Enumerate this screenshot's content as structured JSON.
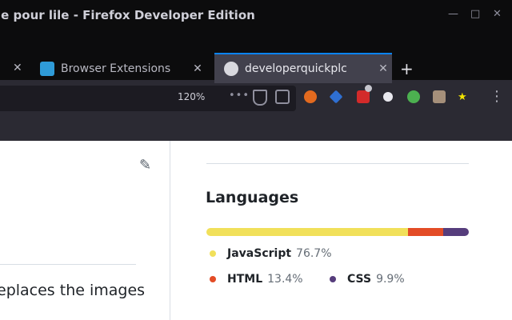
{
  "window": {
    "title": "le pour lile - Firefox Developer Edition"
  },
  "tabs": [
    {
      "label": "Browser Extensions"
    },
    {
      "label": "developerquickplc"
    }
  ],
  "toolbar": {
    "zoom": "120%",
    "overflow_glyph": "•••"
  },
  "page": {
    "description": "eplaces the images",
    "languages": {
      "title": "Languages",
      "items": [
        {
          "name": "JavaScript",
          "percent": "76.7%",
          "value": 76.7,
          "color": "#f1e05a"
        },
        {
          "name": "HTML",
          "percent": "13.4%",
          "value": 13.4,
          "color": "#e34c26"
        },
        {
          "name": "CSS",
          "percent": "9.9%",
          "value": 9.9,
          "color": "#563d7c"
        }
      ]
    }
  },
  "colors": {
    "accent": "#0a84ff",
    "chrome_dark": "#0c0c0d",
    "chrome": "#2b2a33"
  },
  "icons": [
    "minimize-icon",
    "maximize-icon",
    "close-icon",
    "page-favicon",
    "shield-icon",
    "reader-view-icon",
    "edit-pencil-icon",
    "hamburger-menu-icon"
  ]
}
